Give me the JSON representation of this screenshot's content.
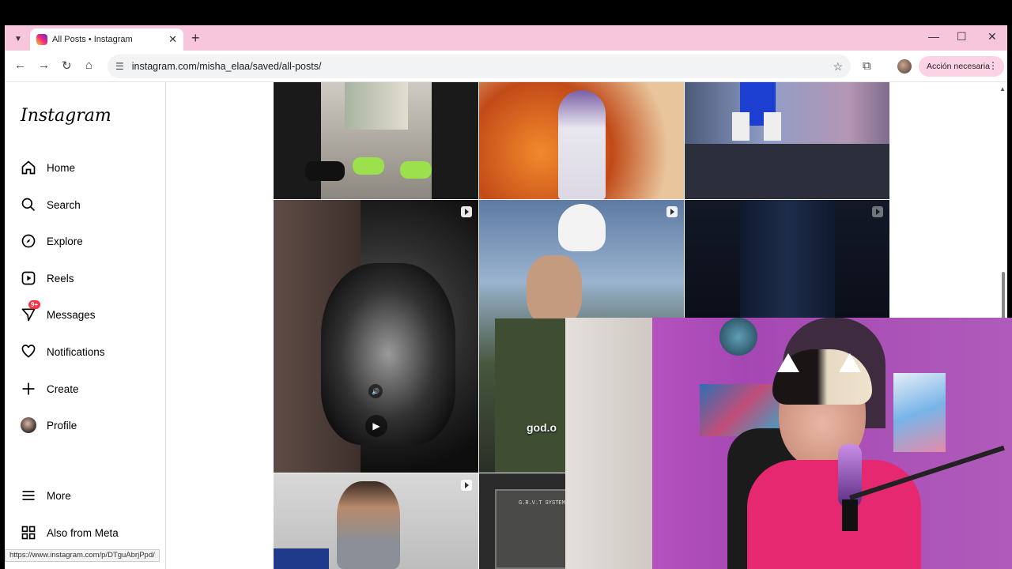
{
  "browser": {
    "tab_title": "All Posts • Instagram",
    "url": "instagram.com/misha_elaa/saved/all-posts/",
    "action_label": "Acción necesaria",
    "status_url": "https://www.instagram.com/p/DTguAbrjPpd/"
  },
  "sidebar": {
    "logo": "Instagram",
    "items": [
      {
        "label": "Home",
        "icon": "home-icon"
      },
      {
        "label": "Search",
        "icon": "search-icon"
      },
      {
        "label": "Explore",
        "icon": "compass-icon"
      },
      {
        "label": "Reels",
        "icon": "reels-icon"
      },
      {
        "label": "Messages",
        "icon": "messenger-icon",
        "badge": "9+"
      },
      {
        "label": "Notifications",
        "icon": "heart-icon"
      },
      {
        "label": "Create",
        "icon": "plus-icon"
      },
      {
        "label": "Profile",
        "icon": "avatar"
      },
      {
        "label": "More",
        "icon": "menu-icon"
      },
      {
        "label": "Also from Meta",
        "icon": "meta-grid-icon"
      }
    ]
  },
  "grid": {
    "overlay_text": "god.o",
    "sign_text": "G.R.V.T SYSTEM"
  },
  "colors": {
    "tabstrip": "#f7c6dd",
    "badge": "#ff3040"
  }
}
